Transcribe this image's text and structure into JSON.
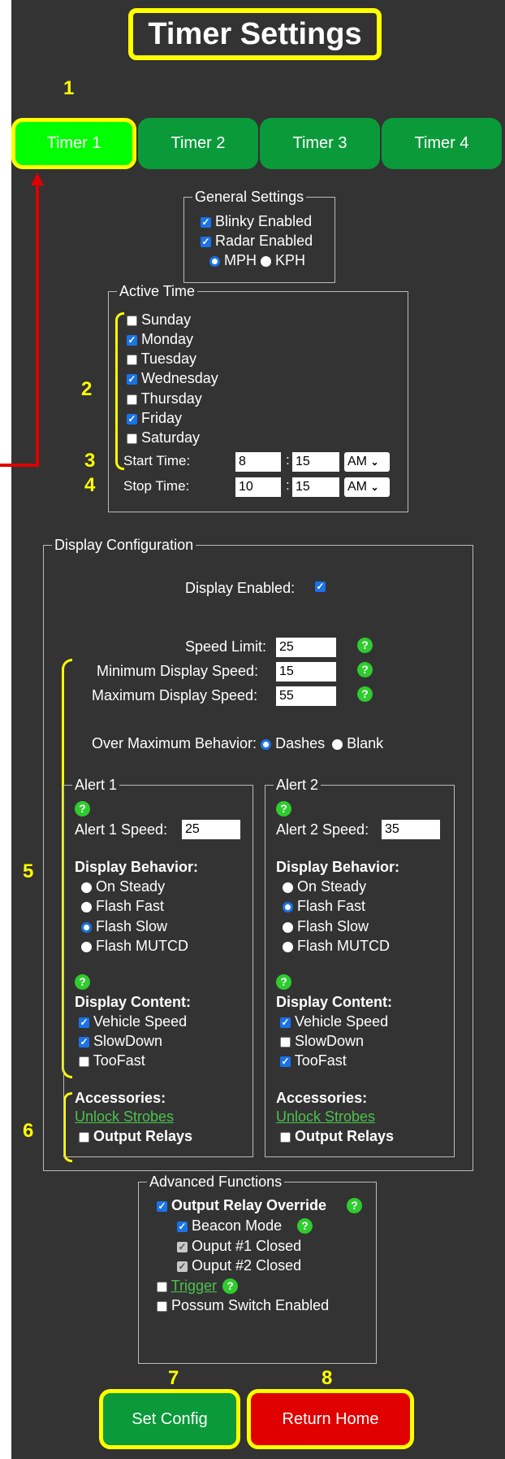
{
  "page": {
    "title": "Timer Settings"
  },
  "annotations": [
    "1",
    "2",
    "3",
    "4",
    "5",
    "6",
    "7",
    "8"
  ],
  "tabs": [
    {
      "label": "Timer 1",
      "active": true
    },
    {
      "label": "Timer 2",
      "active": false
    },
    {
      "label": "Timer 3",
      "active": false
    },
    {
      "label": "Timer 4",
      "active": false
    }
  ],
  "general": {
    "legend": "General Settings",
    "blinky": "Blinky Enabled",
    "radar": "Radar Enabled",
    "mph": "MPH",
    "kph": "KPH"
  },
  "active_time": {
    "legend": "Active Time",
    "days": [
      {
        "label": "Sunday",
        "checked": false
      },
      {
        "label": "Monday",
        "checked": true
      },
      {
        "label": "Tuesday",
        "checked": false
      },
      {
        "label": "Wednesday",
        "checked": true
      },
      {
        "label": "Thursday",
        "checked": false
      },
      {
        "label": "Friday",
        "checked": true
      },
      {
        "label": "Saturday",
        "checked": false
      }
    ],
    "start_label": "Start Time:",
    "start_hour": "8",
    "start_min": "15",
    "start_ampm": "AM",
    "stop_label": "Stop Time:",
    "stop_hour": "10",
    "stop_min": "15",
    "stop_ampm": "AM",
    "colon": ":"
  },
  "display": {
    "legend": "Display Configuration",
    "enabled_label": "Display Enabled:",
    "speed_limit_label": "Speed Limit:",
    "speed_limit": "25",
    "min_label": "Minimum Display Speed:",
    "min": "15",
    "max_label": "Maximum Display Speed:",
    "max": "55",
    "over_label": "Over Maximum Behavior:",
    "dashes": "Dashes",
    "blank": "Blank"
  },
  "alerts": [
    {
      "legend": "Alert 1",
      "speed_label": "Alert 1 Speed:",
      "speed": "25",
      "behavior_title": "Display Behavior:",
      "behaviors": [
        "On Steady",
        "Flash Fast",
        "Flash Slow",
        "Flash MUTCD"
      ],
      "selected": 2,
      "content_title": "Display Content:",
      "content": [
        {
          "label": "Vehicle Speed",
          "checked": true
        },
        {
          "label": "SlowDown",
          "checked": true
        },
        {
          "label": "TooFast",
          "checked": false
        }
      ],
      "accessories_title": "Accessories:",
      "unlock": "Unlock Strobes",
      "relays": "Output Relays"
    },
    {
      "legend": "Alert 2",
      "speed_label": "Alert 2 Speed:",
      "speed": "35",
      "behavior_title": "Display Behavior:",
      "behaviors": [
        "On Steady",
        "Flash Fast",
        "Flash Slow",
        "Flash MUTCD"
      ],
      "selected": 1,
      "content_title": "Display Content:",
      "content": [
        {
          "label": "Vehicle Speed",
          "checked": true
        },
        {
          "label": "SlowDown",
          "checked": false
        },
        {
          "label": "TooFast",
          "checked": true
        }
      ],
      "accessories_title": "Accessories:",
      "unlock": "Unlock Strobes",
      "relays": "Output Relays"
    }
  ],
  "advanced": {
    "legend": "Advanced Functions",
    "override": "Output Relay Override",
    "beacon": "Beacon Mode",
    "out1": "Ouput #1 Closed",
    "out2": "Ouput #2 Closed",
    "trigger": "Trigger",
    "possum": "Possum Switch Enabled"
  },
  "buttons": {
    "set": "Set Config",
    "home": "Return Home"
  },
  "help_glyph": "?",
  "colors": {
    "accent_green": "#0a9a3a",
    "active_tab": "#00ff00",
    "highlight": "#ffff00",
    "home_red": "#e00000",
    "background": "#333333"
  }
}
